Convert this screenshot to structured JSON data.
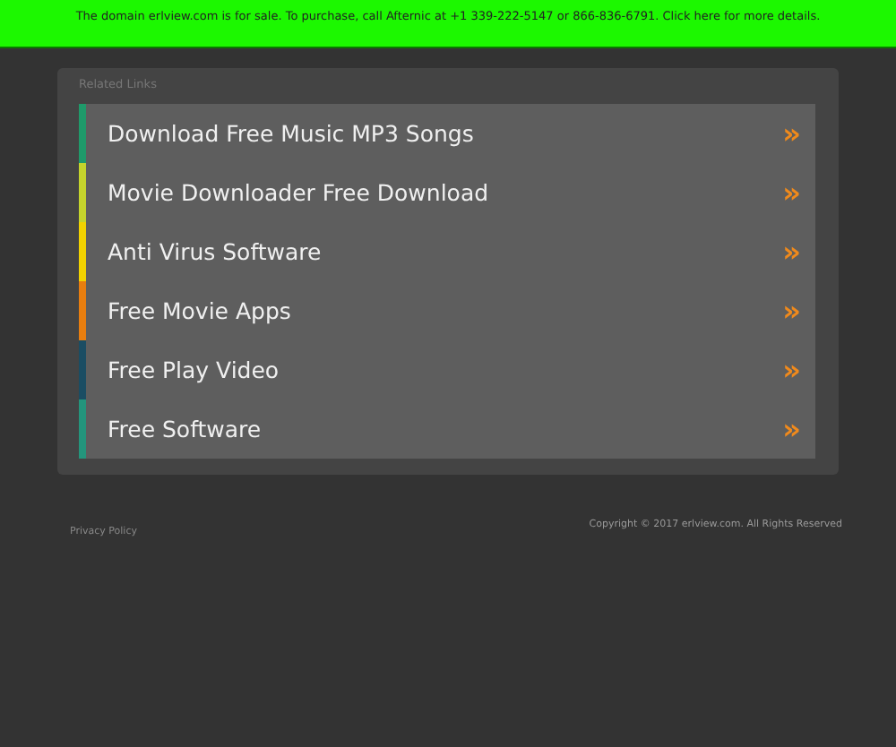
{
  "banner": {
    "text": "The domain erlview.com is for sale. To purchase, call Afternic at +1 339-222-5147 or 866-836-6791. Click here for more details."
  },
  "related_links": {
    "title": "Related Links",
    "items": [
      {
        "label": "Download Free Music MP3 Songs",
        "color": "#1f9a6a",
        "arrow": "»"
      },
      {
        "label": "Movie Downloader Free Download",
        "color": "#c5d42c",
        "arrow": "»"
      },
      {
        "label": "Anti Virus Software",
        "color": "#f2d200",
        "arrow": "»"
      },
      {
        "label": "Free Movie Apps",
        "color": "#e87e0f",
        "arrow": "»"
      },
      {
        "label": "Free Play Video",
        "color": "#1b4d63",
        "arrow": "»"
      },
      {
        "label": "Free Software",
        "color": "#24957c",
        "arrow": "»"
      }
    ]
  },
  "footer": {
    "privacy": "Privacy Policy",
    "copyright": "Copyright © 2017 erlview.com. All Rights Reserved"
  }
}
